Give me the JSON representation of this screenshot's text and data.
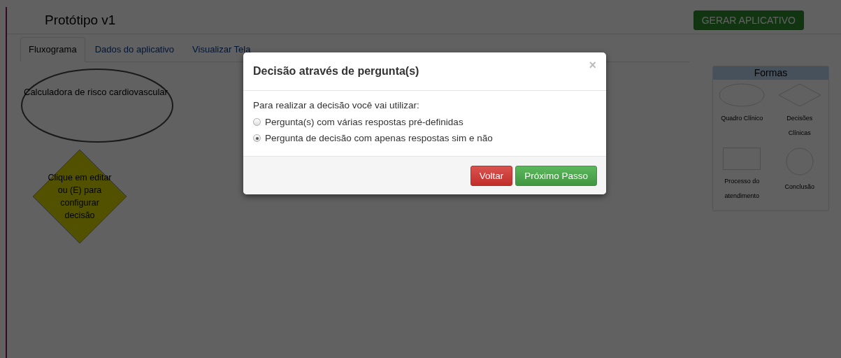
{
  "header": {
    "title": "Protótipo v1",
    "generate_button": "GERAR APLICATIVO"
  },
  "tabs": [
    {
      "label": "Fluxograma",
      "selected": true
    },
    {
      "label": "Dados do aplicativo",
      "selected": false
    },
    {
      "label": "Visualizar Tela",
      "selected": false
    }
  ],
  "canvas": {
    "nodes": [
      {
        "kind": "ellipse",
        "label": "Calculadora de risco cardiovascular"
      },
      {
        "kind": "diamond",
        "label": "Clique em editar ou (E) para configurar decisão"
      }
    ]
  },
  "palette": {
    "title": "Formas",
    "shapes": [
      {
        "kind": "ellipse",
        "label": "Quadro Clínico"
      },
      {
        "kind": "diamond",
        "label": "Decisões Clínicas"
      },
      {
        "kind": "rect",
        "label": "Processo do atendimento"
      },
      {
        "kind": "circle",
        "label": "Conclusão"
      }
    ]
  },
  "modal": {
    "title": "Decisão através de pergunta(s)",
    "close": "×",
    "prompt": "Para realizar a decisão você vai utilizar:",
    "options": [
      {
        "label": "Pergunta(s) com várias respostas pré-definidas",
        "selected": false
      },
      {
        "label": "Pergunta de decisão com apenas respostas sim e não",
        "selected": true
      }
    ],
    "buttons": [
      {
        "kind": "danger",
        "label": "Voltar"
      },
      {
        "kind": "success",
        "label": "Próximo Passo"
      }
    ]
  }
}
